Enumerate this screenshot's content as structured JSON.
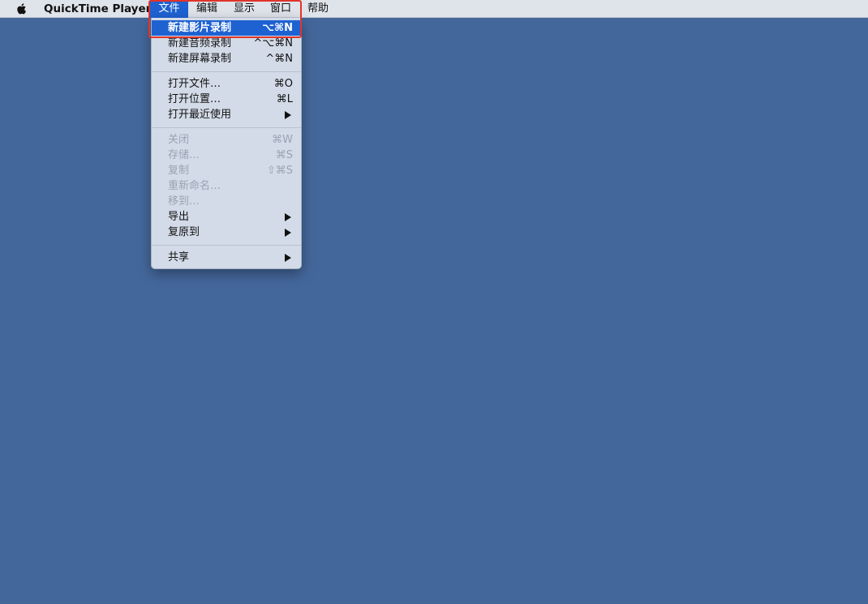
{
  "menubar": {
    "apple_icon": "apple-logo-icon",
    "app_name": "QuickTime Player",
    "items": [
      "文件",
      "编辑",
      "显示",
      "窗口",
      "帮助"
    ]
  },
  "file_menu": {
    "items": [
      {
        "label": "新建影片录制",
        "shortcut": "⌥⌘N"
      },
      {
        "label": "新建音频录制",
        "shortcut": "^⌥⌘N"
      },
      {
        "label": "新建屏幕录制",
        "shortcut": "^⌘N"
      },
      {
        "label": "打开文件…",
        "shortcut": "⌘O"
      },
      {
        "label": "打开位置…",
        "shortcut": "⌘L"
      },
      {
        "label": "打开最近使用",
        "shortcut": ""
      },
      {
        "label": "关闭",
        "shortcut": "⌘W"
      },
      {
        "label": "存储…",
        "shortcut": "⌘S"
      },
      {
        "label": "复制",
        "shortcut": "⇧⌘S"
      },
      {
        "label": "重新命名…",
        "shortcut": ""
      },
      {
        "label": "移到…",
        "shortcut": ""
      },
      {
        "label": "导出",
        "shortcut": ""
      },
      {
        "label": "复原到",
        "shortcut": ""
      },
      {
        "label": "共享",
        "shortcut": ""
      }
    ]
  },
  "colors": {
    "desktop": "#44679b",
    "menubar": "#dfe3ea",
    "selection": "#1e62d2",
    "highlight_border": "#e0352a"
  }
}
